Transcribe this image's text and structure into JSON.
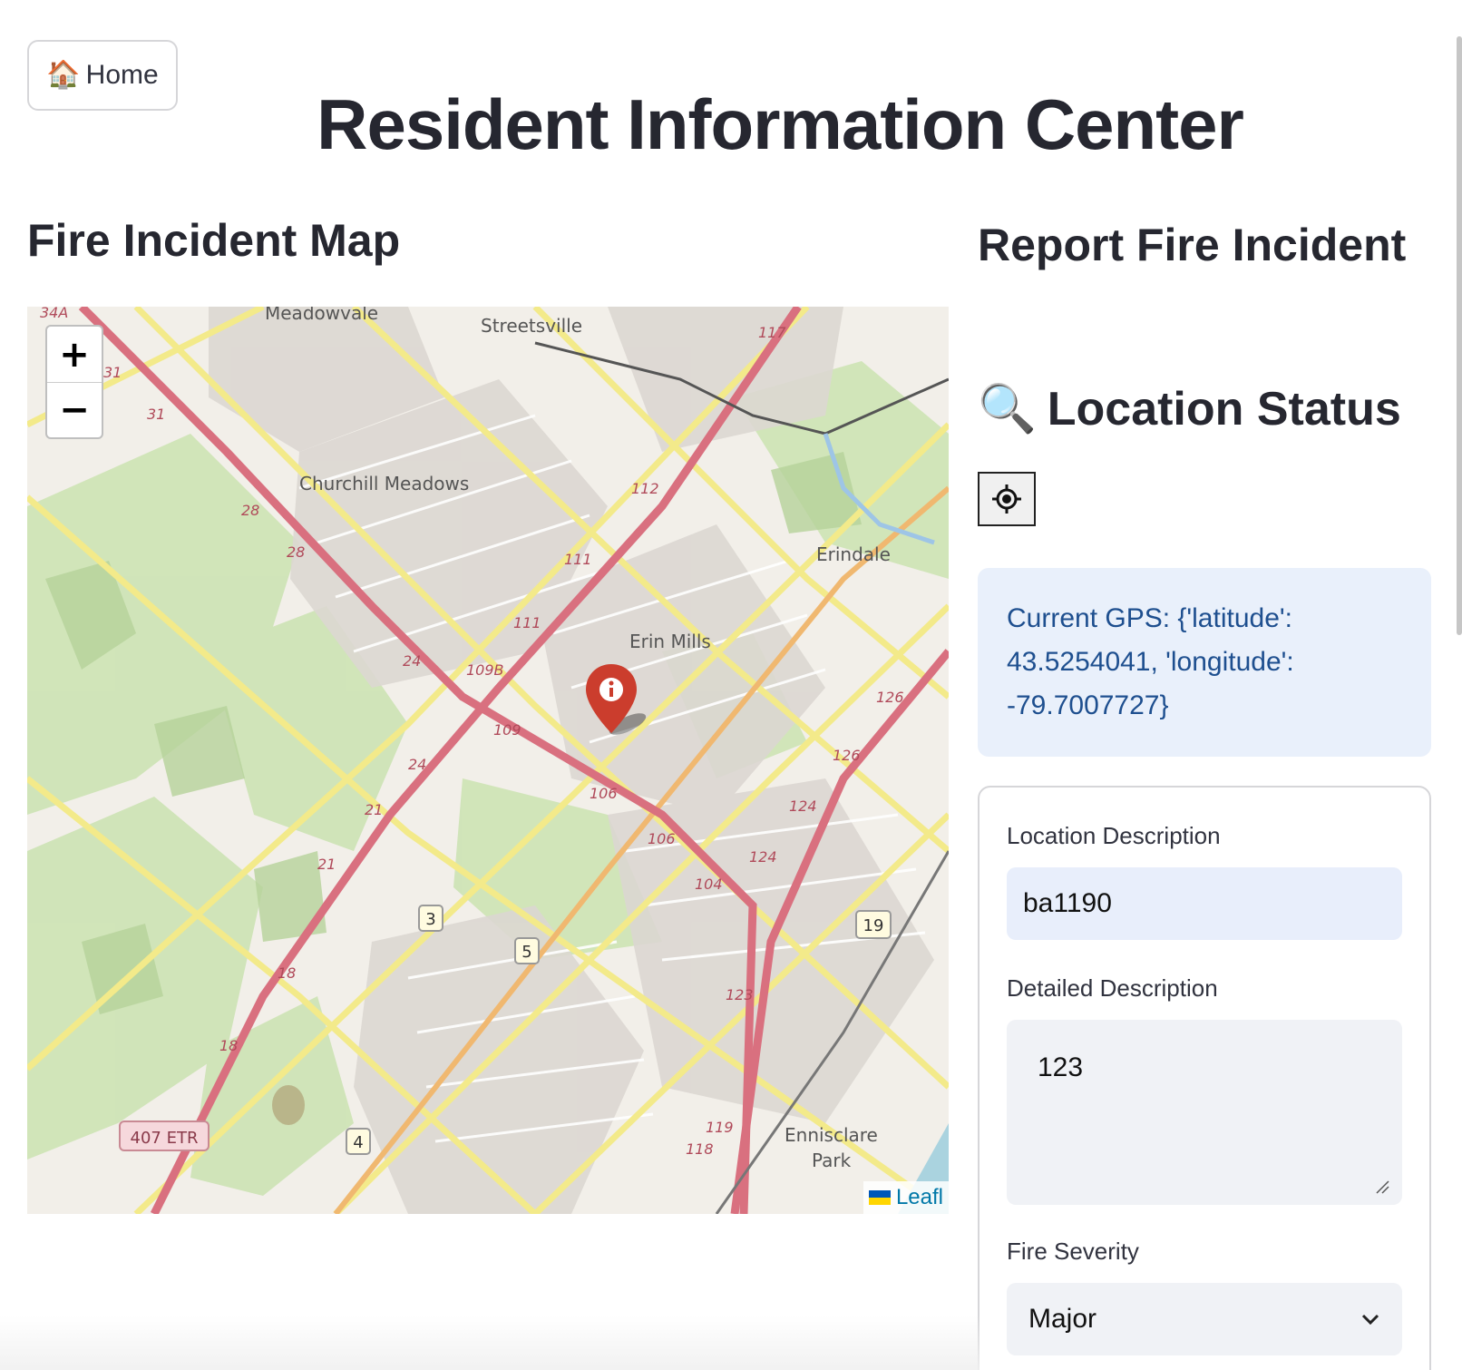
{
  "nav": {
    "home_label": "Home",
    "home_icon": "house-icon"
  },
  "page": {
    "title": "Resident Information Center"
  },
  "map": {
    "heading": "Fire Incident Map",
    "zoom_in": "+",
    "zoom_out": "−",
    "attribution": "Leafl",
    "marker_icon": "info-marker-icon",
    "place_labels": [
      "Meadowvale",
      "Streetsville",
      "Churchill Meadows",
      "Erindale",
      "Erin Mills",
      "Ennisclare",
      "Park"
    ],
    "road_labels": [
      "34A",
      "31",
      "31",
      "28",
      "28",
      "24",
      "24",
      "21",
      "21",
      "18",
      "18",
      "117",
      "112",
      "111",
      "111",
      "109B",
      "109",
      "106",
      "106",
      "104",
      "126",
      "126",
      "124",
      "124",
      "123",
      "119",
      "118"
    ],
    "shields": [
      "407 ETR",
      "3",
      "5",
      "4",
      "19"
    ]
  },
  "report": {
    "heading": "Report Fire Incident",
    "location_status": "Location Status",
    "location_icon": "magnifier-icon",
    "gps_button_icon": "crosshair-icon",
    "gps_info": "Current GPS: {'latitude': 43.5254041, 'longitude': -79.7007727}",
    "location_description_label": "Location Description",
    "location_description_value": "ba1190",
    "detailed_description_label": "Detailed Description",
    "detailed_description_value": "123",
    "fire_severity_label": "Fire Severity",
    "fire_severity_value": "Major"
  },
  "colors": {
    "accent_info_bg": "#e9f0fb",
    "info_text": "#1e4f8f",
    "marker": "#cb3d2d",
    "major_road": "#e58a9a",
    "arterial_road": "#f6f08a"
  }
}
